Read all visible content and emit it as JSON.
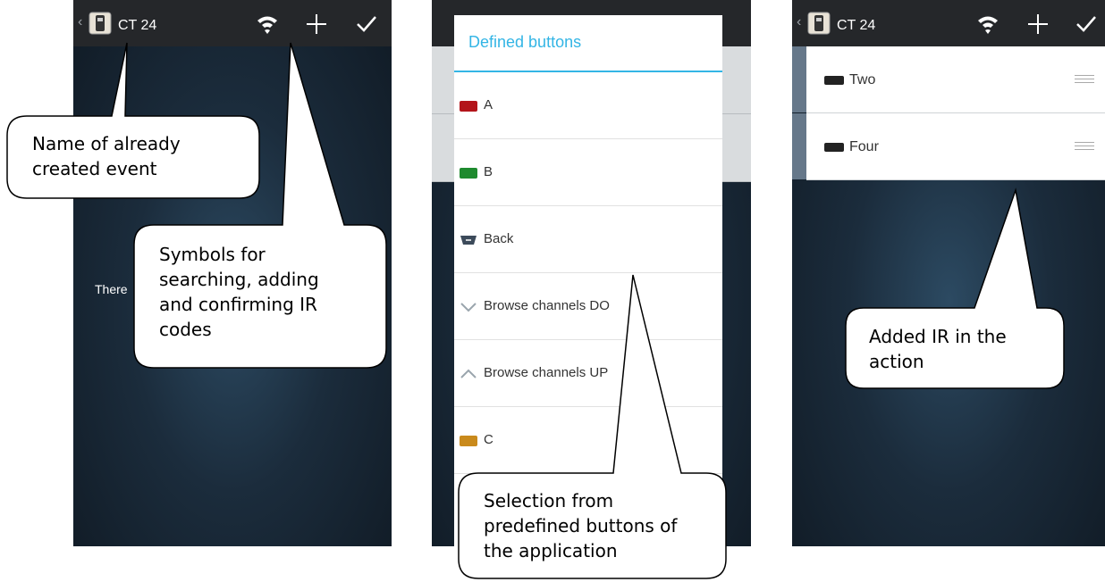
{
  "screens": {
    "event_title": "CT 24",
    "empty_message": "There",
    "dialog": {
      "title": "Defined buttons",
      "items": [
        {
          "label": "A",
          "icon": "red-swatch-icon",
          "color": "#b3141a"
        },
        {
          "label": "B",
          "icon": "green-swatch-icon",
          "color": "#1e8a2e"
        },
        {
          "label": "Back",
          "icon": "back-button-icon",
          "color": "#3c4a5a"
        },
        {
          "label": "Browse channels DO",
          "icon": "chevron-down-icon",
          "color": "#9aa5ad"
        },
        {
          "label": "Browse channels UP",
          "icon": "chevron-up-icon",
          "color": "#9aa5ad"
        },
        {
          "label": "C",
          "icon": "yellow-swatch-icon",
          "color": "#c98a1c"
        }
      ]
    },
    "action_items": [
      {
        "label": "Two",
        "icon": "black-swatch-icon"
      },
      {
        "label": "Four",
        "icon": "black-swatch-icon"
      }
    ]
  },
  "callouts": {
    "event_name": "Name of already created event",
    "symbols_line1": "Symbols for",
    "symbols_line2": "searching, adding",
    "symbols_line3": "and confirming IR",
    "symbols_line4": "codes",
    "selection_line1": "Selection from",
    "selection_line2": "predefined buttons of",
    "selection_line3": "the application",
    "added_line1": "Added IR in the",
    "added_line2": "action"
  },
  "colors": {
    "accent": "#33b5e5",
    "actionbar": "#25272a",
    "row_strip": "#66788a"
  }
}
